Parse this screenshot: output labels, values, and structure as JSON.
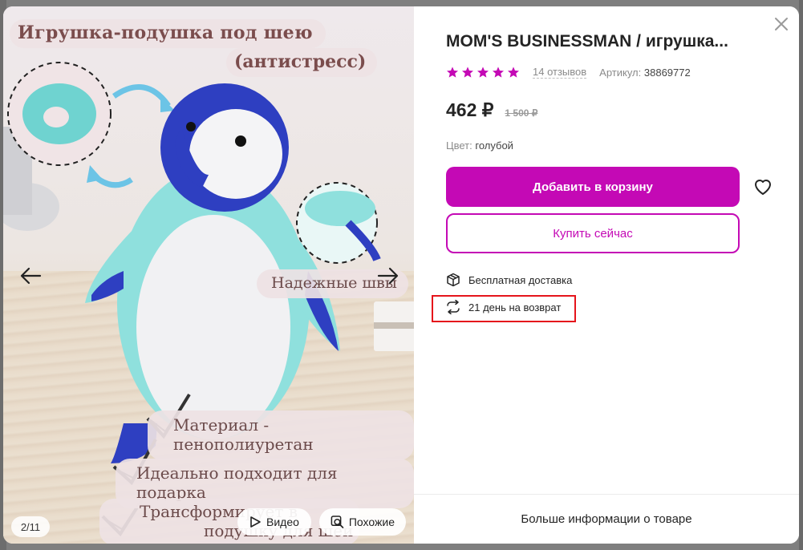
{
  "gallery": {
    "caption_title_line1": "Игрушка-подушка под шею",
    "caption_title_line2": "(антистресс)",
    "caption_seams": "Надежные швы",
    "caption_material": "Материал - пенополиуретан",
    "caption_gift": "Идеально подходит для подарка",
    "caption_transform_line1": "Трансформирует в",
    "caption_transform_line2": "подушку для шеи",
    "counter": "2/11",
    "video_label": "Видео",
    "similar_label": "Похожие"
  },
  "product": {
    "title": "MOM'S BUSINESSMAN / игрушка...",
    "rating": 5,
    "reviews": "14 отзывов",
    "article_label": "Артикул:",
    "article_value": "38869772",
    "price": "462 ₽",
    "old_price": "1 500 ₽",
    "color_label": "Цвет:",
    "color_value": "голубой",
    "add_to_cart": "Добавить в корзину",
    "buy_now": "Купить сейчас",
    "delivery": "Бесплатная доставка",
    "return": "21 день на возврат",
    "more_info": "Больше информации о товаре"
  },
  "colors": {
    "accent": "#c409b5",
    "star": "#c409b5",
    "highlight": "#e5141b"
  },
  "icons": {
    "close": "close-icon",
    "favorite": "heart-icon",
    "delivery": "box-icon",
    "return": "return-arrows-icon",
    "prev": "arrow-left-icon",
    "next": "arrow-right-icon",
    "video": "play-icon",
    "similar": "search-similar-icon"
  }
}
